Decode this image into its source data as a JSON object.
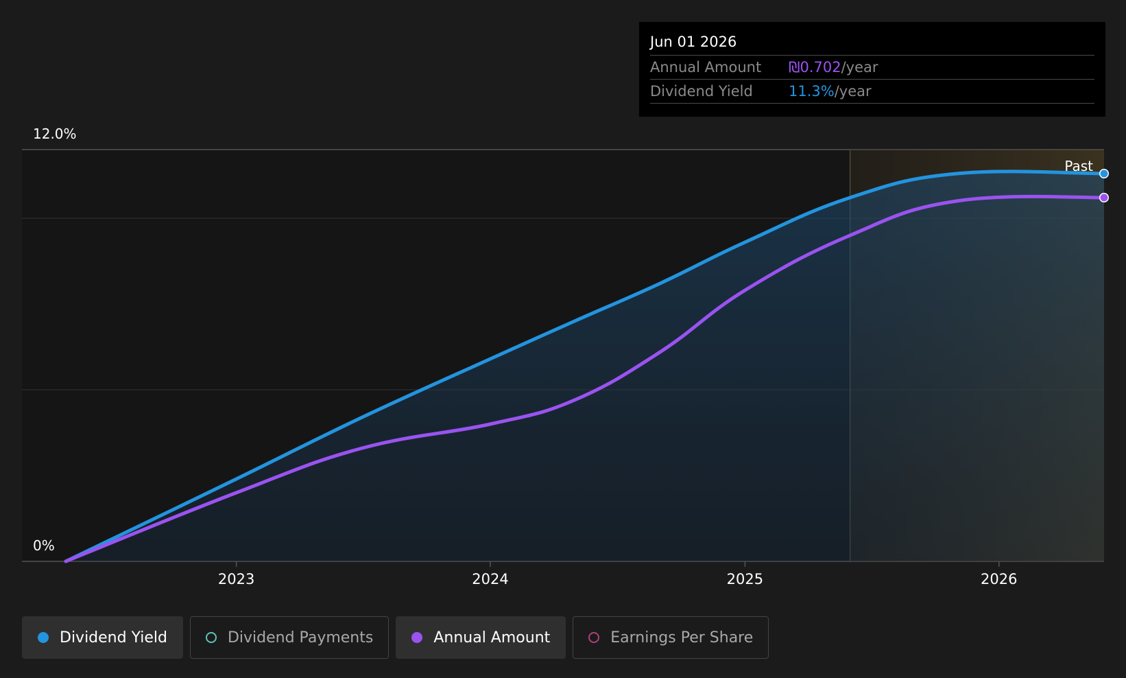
{
  "colors": {
    "background": "#1b1b1b",
    "dividend_yield": "#2394df",
    "annual_amount": "#9a53f0",
    "dividend_payments": "#5ec4b6",
    "earnings_per_share": "#b0407c"
  },
  "tooltip": {
    "date": "Jun 01 2026",
    "rows": [
      {
        "label": "Annual Amount",
        "value": "₪0.702",
        "unit": "/year",
        "color": "#9a53f0"
      },
      {
        "label": "Dividend Yield",
        "value": "11.3%",
        "unit": "/year",
        "color": "#2394df"
      }
    ]
  },
  "legend": [
    {
      "label": "Dividend Yield",
      "active": true,
      "color": "#2394df",
      "icon": "filled-dot-icon"
    },
    {
      "label": "Dividend Payments",
      "active": false,
      "color": "#5ec4b6",
      "icon": "hollow-dot-icon"
    },
    {
      "label": "Annual Amount",
      "active": true,
      "color": "#9a53f0",
      "icon": "filled-dot-icon"
    },
    {
      "label": "Earnings Per Share",
      "active": false,
      "color": "#b0407c",
      "icon": "hollow-dot-icon"
    }
  ],
  "chart_data": {
    "type": "area",
    "y_tick_labels": [
      "0%",
      "12.0%"
    ],
    "ylim": [
      0,
      12
    ],
    "x_tick_labels": [
      "2023",
      "2024",
      "2025",
      "2026"
    ],
    "xlim": [
      "2022-05-01",
      "2026-06-01"
    ],
    "past_label": "Past",
    "forecast_start": "2025-06-01",
    "gridlines": [
      0,
      5,
      10,
      12
    ],
    "series": [
      {
        "name": "Dividend Yield",
        "color": "#2394df",
        "x": [
          "2022-05-01",
          "2023-01-01",
          "2023-07-01",
          "2024-01-01",
          "2024-05-01",
          "2024-09-01",
          "2025-01-01",
          "2025-06-01",
          "2025-11-01",
          "2026-06-01"
        ],
        "y": [
          0,
          2.4,
          4.2,
          5.9,
          7.0,
          8.1,
          9.3,
          10.6,
          11.3,
          11.3
        ]
      },
      {
        "name": "Annual Amount",
        "color": "#9a53f0",
        "x": [
          "2022-05-01",
          "2023-01-01",
          "2023-07-01",
          "2024-01-01",
          "2024-05-01",
          "2024-09-01",
          "2025-01-01",
          "2025-06-01",
          "2025-11-01",
          "2026-06-01"
        ],
        "y": [
          0,
          2.0,
          3.3,
          4.0,
          4.7,
          6.1,
          7.9,
          9.5,
          10.5,
          10.6
        ]
      }
    ]
  }
}
